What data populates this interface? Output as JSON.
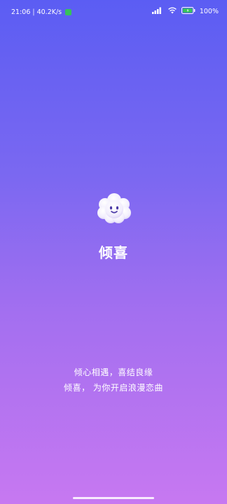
{
  "status_bar": {
    "time": "21:06",
    "separator": "|",
    "net_speed": "40.2K/s",
    "battery": "100%"
  },
  "icons": {
    "app_logo": "cloud-smile-icon",
    "signal": "signal-icon",
    "wifi": "wifi-icon",
    "battery": "battery-icon"
  },
  "app": {
    "name": "倾喜"
  },
  "slogan": {
    "line1": "倾心相遇，喜结良缘",
    "line2": "倾喜， 为你开启浪漫恋曲"
  },
  "colors": {
    "gradient_top": "#5b5df3",
    "gradient_bottom": "#c778f1",
    "status_green": "#37c15b"
  }
}
